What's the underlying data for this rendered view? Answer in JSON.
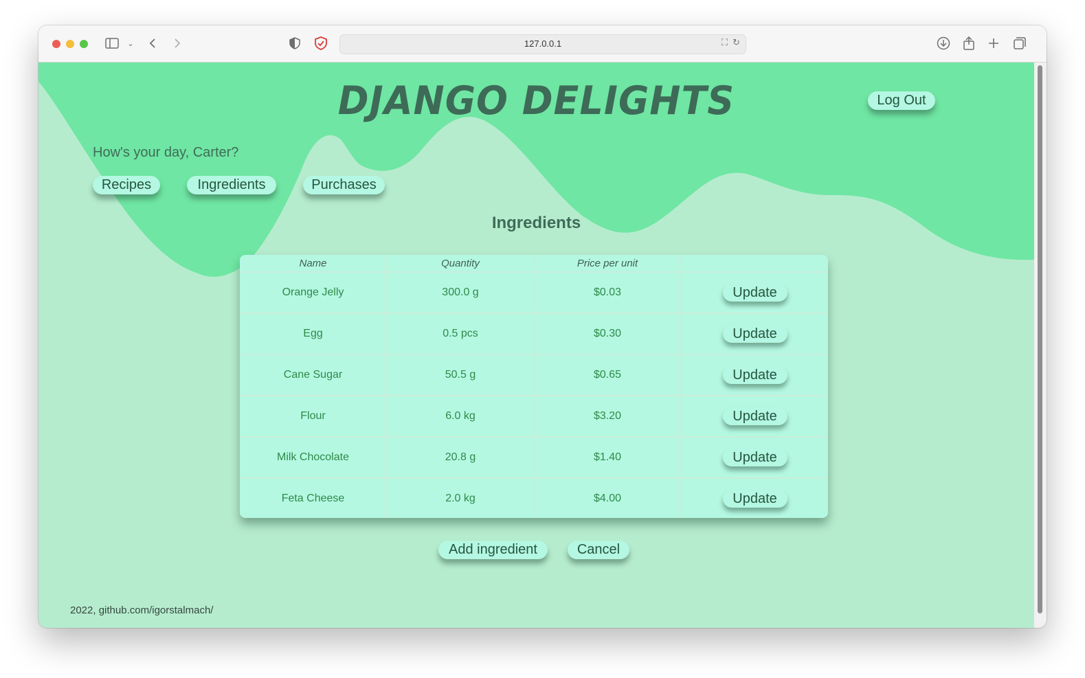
{
  "browser": {
    "url": "127.0.0.1",
    "icons": [
      "sidebar-icon",
      "chevron-down-icon",
      "back-icon",
      "forward-icon",
      "shield-icon",
      "privacy-report-icon",
      "translate-icon",
      "reload-icon",
      "download-icon",
      "share-icon",
      "new-tab-icon",
      "tab-overview-icon"
    ]
  },
  "colors": {
    "background": "#b6ecce",
    "wave": "#6fe6a3",
    "pill": "#b4f7e2",
    "table_text": "#2f8a48"
  },
  "header": {
    "title": "DJANGO DELIGHTS",
    "logout_label": "Log Out"
  },
  "greeting": "How's your day, Carter?",
  "nav": {
    "recipes": "Recipes",
    "ingredients": "Ingredients",
    "purchases": "Purchases"
  },
  "section_title": "Ingredients",
  "table": {
    "headers": [
      "Name",
      "Quantity",
      "Price per unit",
      ""
    ],
    "rows": [
      {
        "name": "Orange Jelly",
        "quantity": "300.0 g",
        "price": "$0.03",
        "action": "Update"
      },
      {
        "name": "Egg",
        "quantity": "0.5 pcs",
        "price": "$0.30",
        "action": "Update"
      },
      {
        "name": "Cane Sugar",
        "quantity": "50.5 g",
        "price": "$0.65",
        "action": "Update"
      },
      {
        "name": "Flour",
        "quantity": "6.0 kg",
        "price": "$3.20",
        "action": "Update"
      },
      {
        "name": "Milk Chocolate",
        "quantity": "20.8 g",
        "price": "$1.40",
        "action": "Update"
      },
      {
        "name": "Feta Cheese",
        "quantity": "2.0 kg",
        "price": "$4.00",
        "action": "Update"
      }
    ]
  },
  "actions": {
    "add_label": "Add ingredient",
    "cancel_label": "Cancel"
  },
  "footer": "2022, github.com/igorstalmach/"
}
